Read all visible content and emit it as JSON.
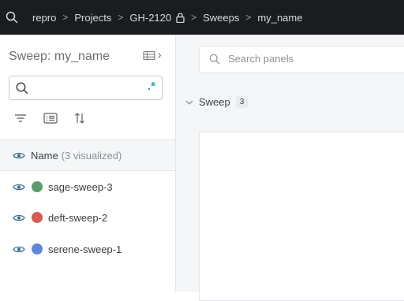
{
  "breadcrumb": {
    "items": [
      "repro",
      "Projects",
      "GH-2120",
      "Sweeps",
      "my_name"
    ],
    "separator": ">"
  },
  "sidebar": {
    "title": "Sweep: my_name",
    "search": {
      "value": "",
      "regex_label": ".*"
    },
    "header": {
      "label": "Name",
      "count": "(3 visualized)"
    },
    "runs": [
      {
        "name": "sage-sweep-3",
        "color": "#5c9b6b"
      },
      {
        "name": "deft-sweep-2",
        "color": "#d65b55"
      },
      {
        "name": "serene-sweep-1",
        "color": "#5f86d9"
      }
    ]
  },
  "main": {
    "search": {
      "placeholder": "Search panels"
    },
    "section": {
      "title": "Sweep",
      "count": "3"
    }
  },
  "colors": {
    "topbar": "#1a1c1f",
    "accent": "#13a9ba",
    "eye": "#3a6e8f"
  }
}
